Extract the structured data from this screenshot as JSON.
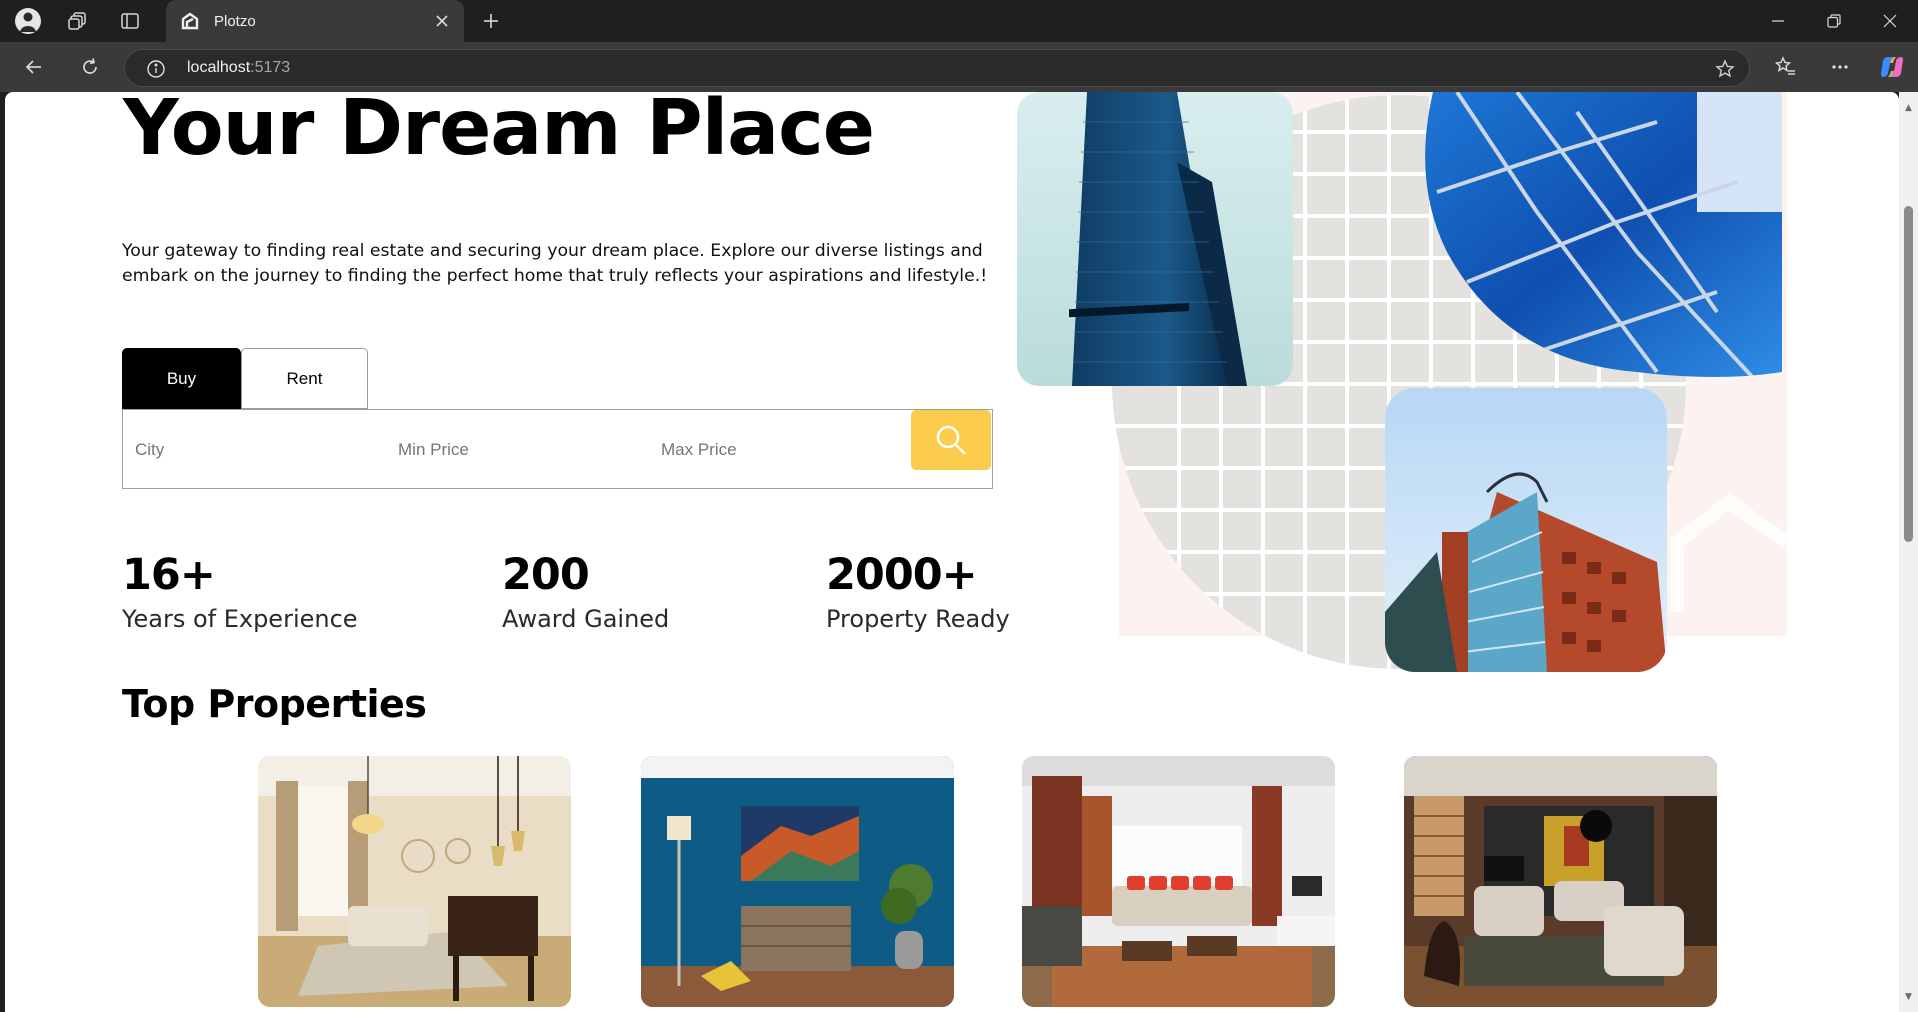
{
  "browser": {
    "tab_title": "Plotzo",
    "url_host": "localhost",
    "url_port": ":5173"
  },
  "hero": {
    "title": "Your Dream Place",
    "description": "Your gateway to finding real estate and securing your dream place. Explore our diverse listings and embark on the journey to finding the perfect home that truly reflects your aspirations and lifestyle.!"
  },
  "search": {
    "tabs": [
      {
        "label": "Buy",
        "active": true
      },
      {
        "label": "Rent",
        "active": false
      }
    ],
    "city_placeholder": "City",
    "min_price_placeholder": "Min Price",
    "max_price_placeholder": "Max Price",
    "button_icon": "search-icon",
    "button_color": "#fccd4d"
  },
  "stats": [
    {
      "value": "16+",
      "label": "Years of Experience"
    },
    {
      "value": "200",
      "label": "Award Gained"
    },
    {
      "value": "2000+",
      "label": "Property Ready"
    }
  ],
  "top_properties": {
    "title": "Top Properties",
    "cards": [
      {
        "alt": "living-room-chandelier"
      },
      {
        "alt": "blue-wall-living-room"
      },
      {
        "alt": "red-cushion-sofa-room"
      },
      {
        "alt": "wood-floor-lounge"
      }
    ]
  }
}
